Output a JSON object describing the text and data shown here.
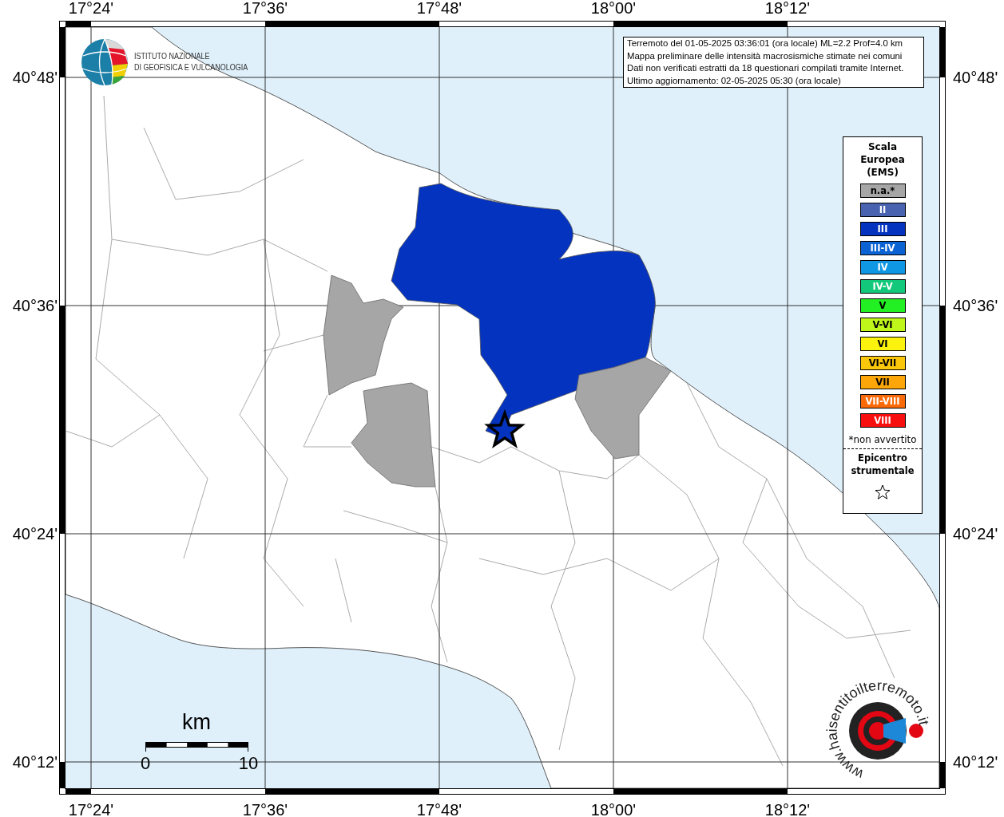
{
  "axes": {
    "top": [
      "17°24'",
      "17°36'",
      "17°48'",
      "18°00'",
      "18°12'"
    ],
    "bottom": [
      "17°24'",
      "17°36'",
      "17°48'",
      "18°00'",
      "18°12'"
    ],
    "left": [
      "40°48'",
      "40°36'",
      "40°24'",
      "40°12'"
    ],
    "right": [
      "40°48'",
      "40°36'",
      "40°24'",
      "40°12'"
    ]
  },
  "institute_logo": {
    "lines": [
      "ISTITUTO NAZIONALE",
      "DI GEOFISICA E VULCANOLOGIA"
    ]
  },
  "info_box": {
    "lines": [
      "Terremoto del 01-05-2025 03:36:01 (ora locale) ML=2.2 Prof=4.0 km",
      "Mappa preliminare delle intensità macrosismiche stimate nei comuni",
      "Dati non verificati estratti da 18 questionari compilati tramite Internet.",
      "Ultimo aggiornamento: 02-05-2025 05:30 (ora locale)"
    ]
  },
  "legend": {
    "title": "Scala Europea (EMS)",
    "items": [
      {
        "label": "n.a.*",
        "color": "#a6a6a6"
      },
      {
        "label": "II",
        "color": "#4a63b0"
      },
      {
        "label": "III",
        "color": "#0433bf"
      },
      {
        "label": "III-IV",
        "color": "#0a62d3"
      },
      {
        "label": "IV",
        "color": "#1097e3"
      },
      {
        "label": "IV-V",
        "color": "#12c87a"
      },
      {
        "label": "V",
        "color": "#23f023"
      },
      {
        "label": "V-VI",
        "color": "#bff71b"
      },
      {
        "label": "VI",
        "color": "#fbf20d"
      },
      {
        "label": "VI-VII",
        "color": "#fbc70b"
      },
      {
        "label": "VII",
        "color": "#fca609"
      },
      {
        "label": "VII-VIII",
        "color": "#fb6a08"
      },
      {
        "label": "VIII",
        "color": "#f70f0f"
      }
    ],
    "footnote": "*non avvertito",
    "epicentre_label": "Epicentro strumentale"
  },
  "scale_bar": {
    "unit": "km",
    "start": "0",
    "end": "10"
  },
  "site_logo": {
    "text": "www.haisentitoilterremoto.it"
  }
}
